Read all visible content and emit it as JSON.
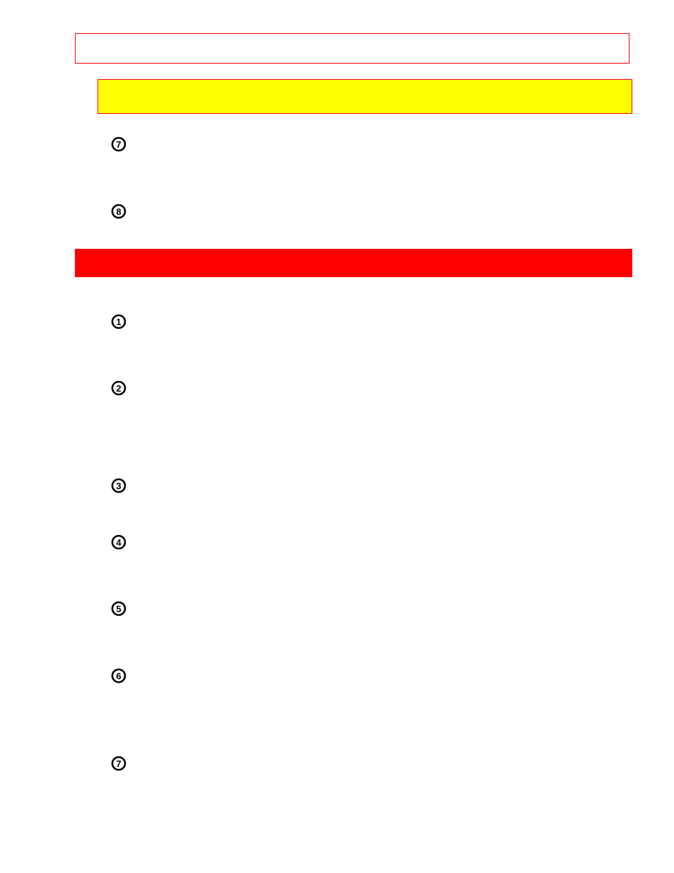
{
  "title_box": {
    "text": ""
  },
  "yellow_box": {
    "text": ""
  },
  "groupA": {
    "items": [
      {
        "marker": "➆",
        "text": ""
      },
      {
        "marker": "➇",
        "text": ""
      }
    ]
  },
  "red_bar": {
    "text": ""
  },
  "groupB": {
    "items": [
      {
        "marker": "➀",
        "text": ""
      },
      {
        "marker": "➁",
        "text": ""
      },
      {
        "marker": "➂",
        "text": ""
      },
      {
        "marker": "➃",
        "text": ""
      },
      {
        "marker": "➄",
        "text": ""
      },
      {
        "marker": "➅",
        "text": ""
      },
      {
        "marker": "➆",
        "text": ""
      }
    ]
  },
  "markers_dingbat": {
    "1": "➀",
    "2": "➁",
    "3": "➂",
    "4": "➃",
    "5": "➄",
    "6": "➅",
    "7": "➆",
    "8": "➇"
  }
}
